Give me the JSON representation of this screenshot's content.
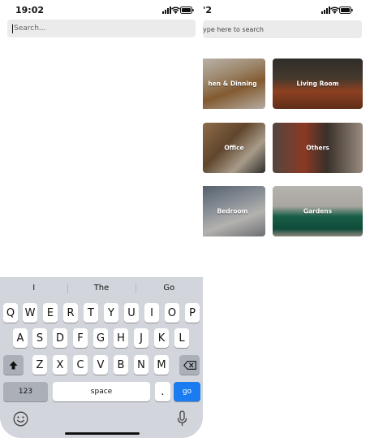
{
  "left_screen": {
    "status": {
      "time": "19:02"
    },
    "search": {
      "placeholder": "Search..."
    },
    "suggestions": [
      "I",
      "The",
      "Go"
    ],
    "keyboard": {
      "row1": [
        "Q",
        "W",
        "E",
        "R",
        "T",
        "Y",
        "U",
        "I",
        "O",
        "P"
      ],
      "row2": [
        "A",
        "S",
        "D",
        "F",
        "G",
        "H",
        "J",
        "K",
        "L"
      ],
      "row3": [
        "Z",
        "X",
        "C",
        "V",
        "B",
        "N",
        "M"
      ],
      "numbers_label": "123",
      "space_label": "space",
      "period_label": ".",
      "go_label": "go"
    }
  },
  "right_screen": {
    "status": {
      "time_fragment": "'2"
    },
    "search": {
      "placeholder": "ype here to search"
    },
    "categories": [
      {
        "label": "hen & Dinning",
        "icon": "kitchen-photo"
      },
      {
        "label": "Living Room",
        "icon": "living-room-photo"
      },
      {
        "label": "Office",
        "icon": "office-photo"
      },
      {
        "label": "Others",
        "icon": "others-photo"
      },
      {
        "label": "Bedroom",
        "icon": "bedroom-photo"
      },
      {
        "label": "Gardens",
        "icon": "gardens-photo"
      }
    ]
  },
  "colors": {
    "go_key": "#1a7cf0",
    "keyboard_bg": "#d2d5db",
    "search_bg": "#ebebeb"
  }
}
